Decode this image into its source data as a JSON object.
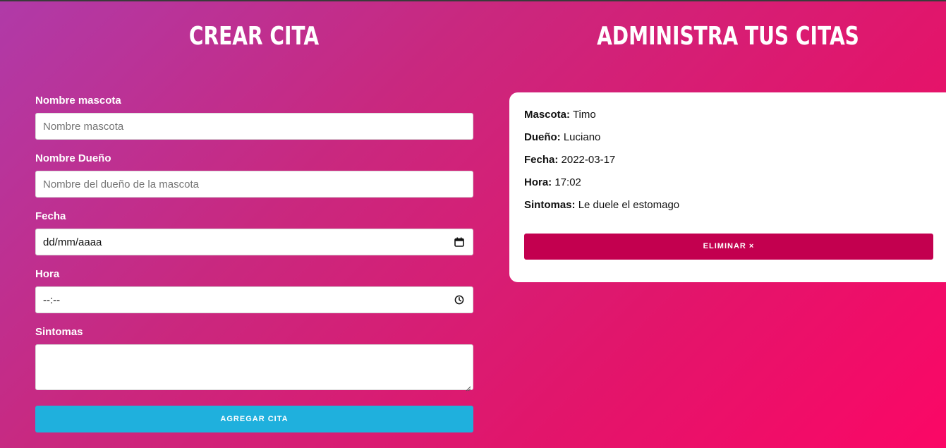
{
  "form": {
    "title": "Crear cita",
    "fields": [
      {
        "label": "Nombre mascota",
        "placeholder": "Nombre mascota",
        "value": ""
      },
      {
        "label": "Nombre Dueño",
        "placeholder": "Nombre del dueño de la mascota",
        "value": ""
      },
      {
        "label": "Fecha",
        "placeholder": "dd/mm/aaaa",
        "value": "",
        "icon": "calendar-icon"
      },
      {
        "label": "Hora",
        "placeholder": "--:--",
        "value": "",
        "icon": "clock-icon"
      },
      {
        "label": "Sintomas",
        "value": ""
      }
    ],
    "submit_label": "Agregar cita"
  },
  "list": {
    "title": "Administra tus citas",
    "appointments": [
      {
        "pet_label": "Mascota:",
        "pet": "Timo",
        "owner_label": "Dueño:",
        "owner": "Luciano",
        "date_label": "Fecha:",
        "date": "2022-03-17",
        "time_label": "Hora:",
        "time": "17:02",
        "symptoms_label": "Sintomas:",
        "symptoms": "Le duele el estomago",
        "delete_label": "Eliminar ×"
      }
    ]
  },
  "colors": {
    "submit_button": "#1fb0dd",
    "delete_button": "#c3004f",
    "background_start": "#b03aa8",
    "background_end": "#fb0766"
  }
}
